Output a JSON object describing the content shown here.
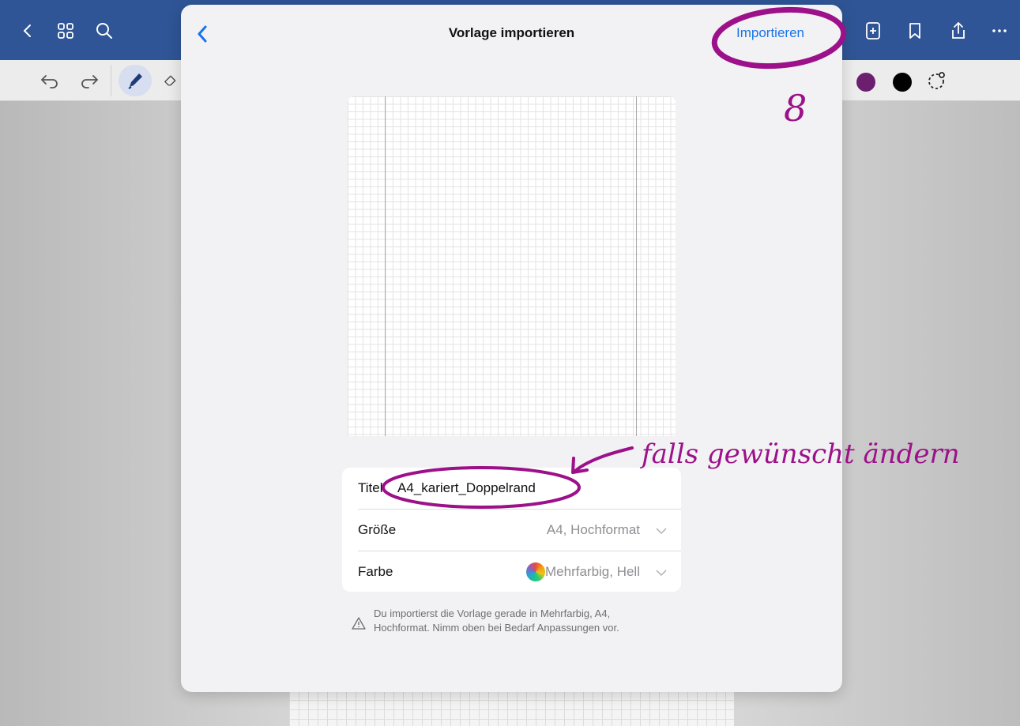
{
  "modal": {
    "back_label": "<",
    "title": "Vorlage importieren",
    "import_label": "Importieren"
  },
  "settings": {
    "title_label": "Titel",
    "title_value": "A4_kariert_Doppelrand",
    "size_label": "Größe",
    "size_value": "A4, Hochformat",
    "color_label": "Farbe",
    "color_value": "Mehrfarbig, Hell"
  },
  "notice": {
    "line1": "Du importierst die Vorlage gerade in Mehrfarbig, A4,",
    "line2": "Hochformat. Nimm oben bei Bedarf Anpassungen vor."
  },
  "annotations": {
    "step_number": "8",
    "hint": "falls gewünscht ändern"
  },
  "colors": {
    "accent": "#1a73e8",
    "topbar": "#2f5596",
    "annotation_ink": "#9c1189",
    "pen_purple": "#6b1f6e",
    "pen_black": "#000000"
  },
  "icons": {
    "topbar_left": [
      "chevron-left-icon",
      "grid-icon",
      "search-icon"
    ],
    "topbar_right": [
      "add-page-icon",
      "bookmark-icon",
      "share-icon",
      "more-icon"
    ],
    "toolbar": [
      "undo-icon",
      "redo-icon",
      "pen-icon",
      "eraser-icon",
      "lasso-icon"
    ]
  }
}
